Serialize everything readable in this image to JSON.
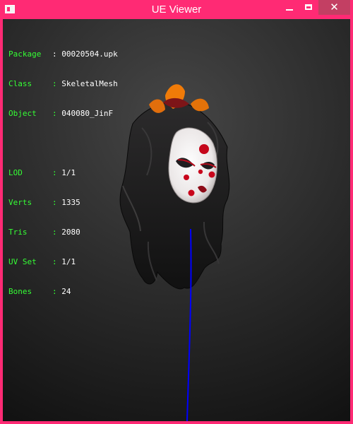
{
  "window": {
    "title": "UE Viewer",
    "buttons": {
      "minimize": "minimize",
      "maximize": "maximize",
      "close": "close"
    }
  },
  "stats": {
    "package_key": "Package",
    "package_value": "00020504.upk",
    "class_key": "Class",
    "class_value": "SkeletalMesh",
    "object_key": "Object",
    "object_value": "040080_JinF",
    "lod_key": "LOD",
    "lod_value": "1/1",
    "verts_key": "Verts",
    "verts_value": "1335",
    "tris_key": "Tris",
    "tris_value": "2080",
    "uvset_key": "UV Set",
    "uvset_value": "1/1",
    "bones_key": "Bones",
    "bones_value": "24"
  },
  "colors": {
    "titlebar": "#ff2a74",
    "close_button": "#c33f63",
    "stat_key": "#35ff35",
    "stat_value": "#ffffff",
    "axis": "#0000ff"
  },
  "icons": [
    "app-icon",
    "minimize-icon",
    "maximize-icon",
    "close-icon"
  ]
}
